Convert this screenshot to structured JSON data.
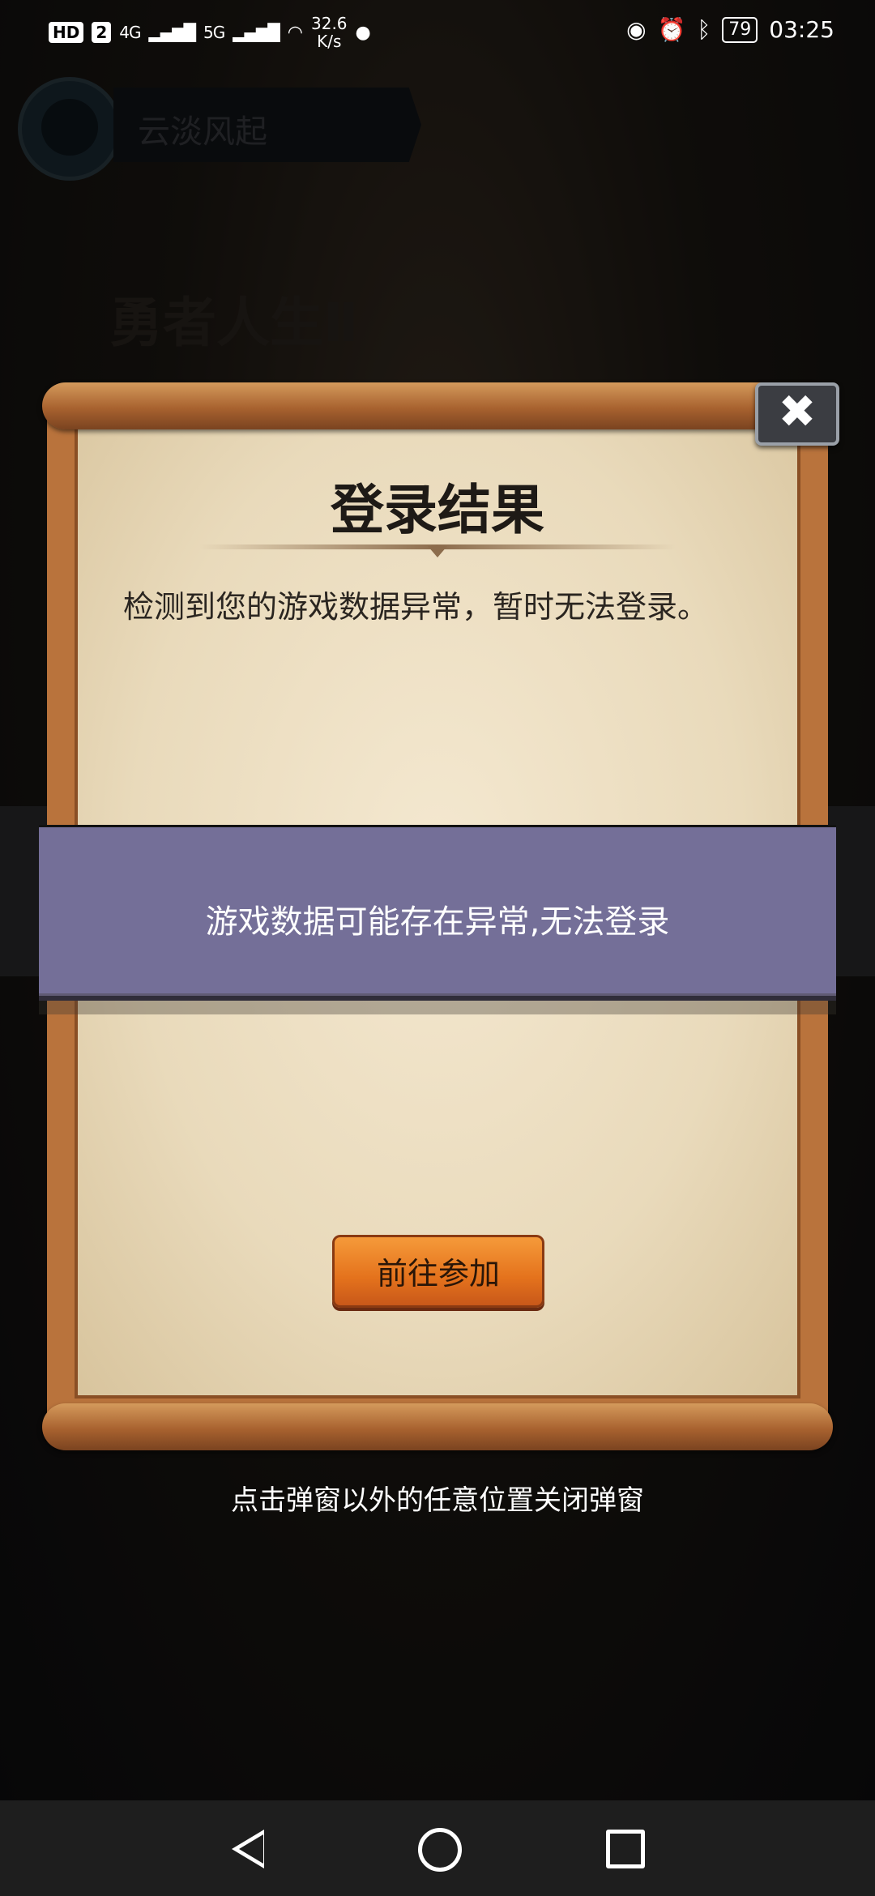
{
  "status_bar": {
    "hd_badge": "HD",
    "sim_slot": "2",
    "network_1": "4G",
    "network_2": "5G",
    "speed_value": "32.6",
    "speed_unit": "K/s",
    "battery": "79",
    "time": "03:25"
  },
  "game": {
    "player_name": "云淡风起",
    "title_line1": "勇者人生Ⅱ"
  },
  "popup": {
    "title": "登录结果",
    "message": "检测到您的游戏数据异常，暂时无法登录。",
    "action_button": "前往参加",
    "close_symbol": "✖"
  },
  "toast": {
    "text": "游戏数据可能存在异常,无法登录"
  },
  "hint": "点击弹窗以外的任意位置关闭弹窗",
  "colors": {
    "toast_bg": "#746f98",
    "button_orange": "#e4721c",
    "scroll_wood": "#b9733c",
    "paper": "#efe3c7"
  }
}
